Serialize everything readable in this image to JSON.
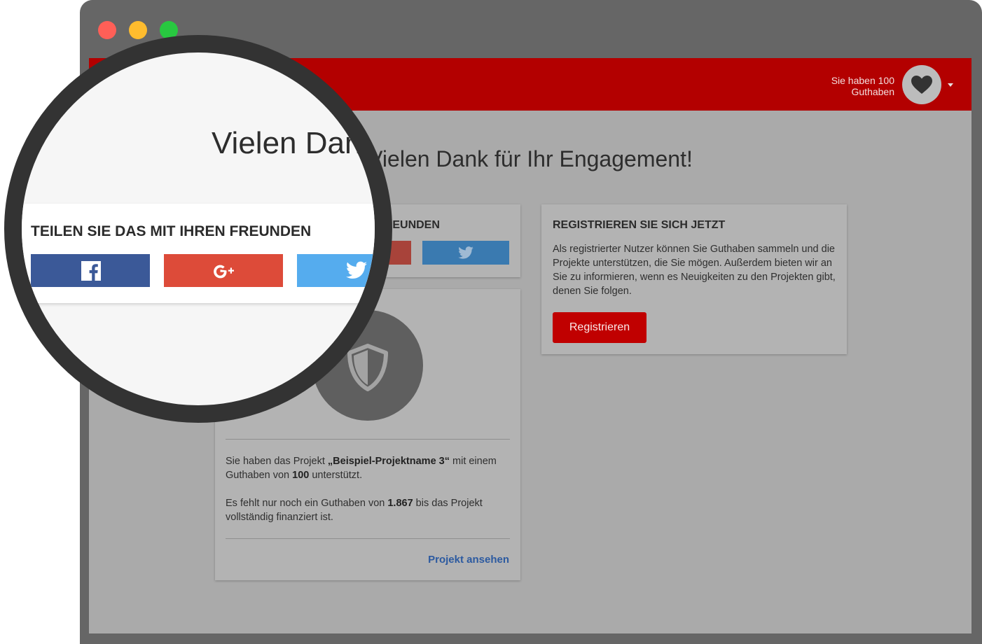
{
  "header": {
    "credits_text": "Sie haben 100 Guthaben"
  },
  "page": {
    "title": "Vielen Dank für Ihr Engagement!"
  },
  "share": {
    "title": "TEILEN SIE DAS MIT IHREN FREUNDEN",
    "buttons": [
      {
        "name": "facebook",
        "color": "#3b5998",
        "icon": "facebook-icon"
      },
      {
        "name": "google-plus",
        "color": "#dd4b39",
        "icon": "google-plus-icon"
      },
      {
        "name": "twitter",
        "color": "#55acee",
        "icon": "twitter-icon"
      }
    ]
  },
  "register": {
    "title": "REGISTRIEREN SIE SICH JETZT",
    "text": "Als registrierter Nutzer können Sie Guthaben sammeln und die Projekte unterstützen, die Sie mögen. Außerdem bieten wir an Sie zu informieren, wenn es Neuigkeiten zu den Projekten gibt, denen Sie folgen.",
    "button_label": "Registrieren"
  },
  "project": {
    "text1_a": "Sie haben das Projekt ",
    "text1_name": "„Beispiel-Projektname 3“",
    "text1_b": " mit einem Guthaben von ",
    "text1_amount": "100",
    "text1_c": " unterstützt.",
    "text2_a": "Es fehlt nur noch ein Guthaben von ",
    "text2_amount": "1.867",
    "text2_b": " bis das Projekt vollständig finanziert ist.",
    "link_label": "Projekt ansehen"
  },
  "magnifier": {
    "title": "Vielen Dank für Ihr Engagement!",
    "share_title": "TEILEN SIE DAS MIT IHREN FREUNDEN"
  },
  "colors": {
    "brand_red": "#b30000",
    "facebook": "#3b5998",
    "google_plus": "#dd4b39",
    "twitter": "#55acee"
  }
}
